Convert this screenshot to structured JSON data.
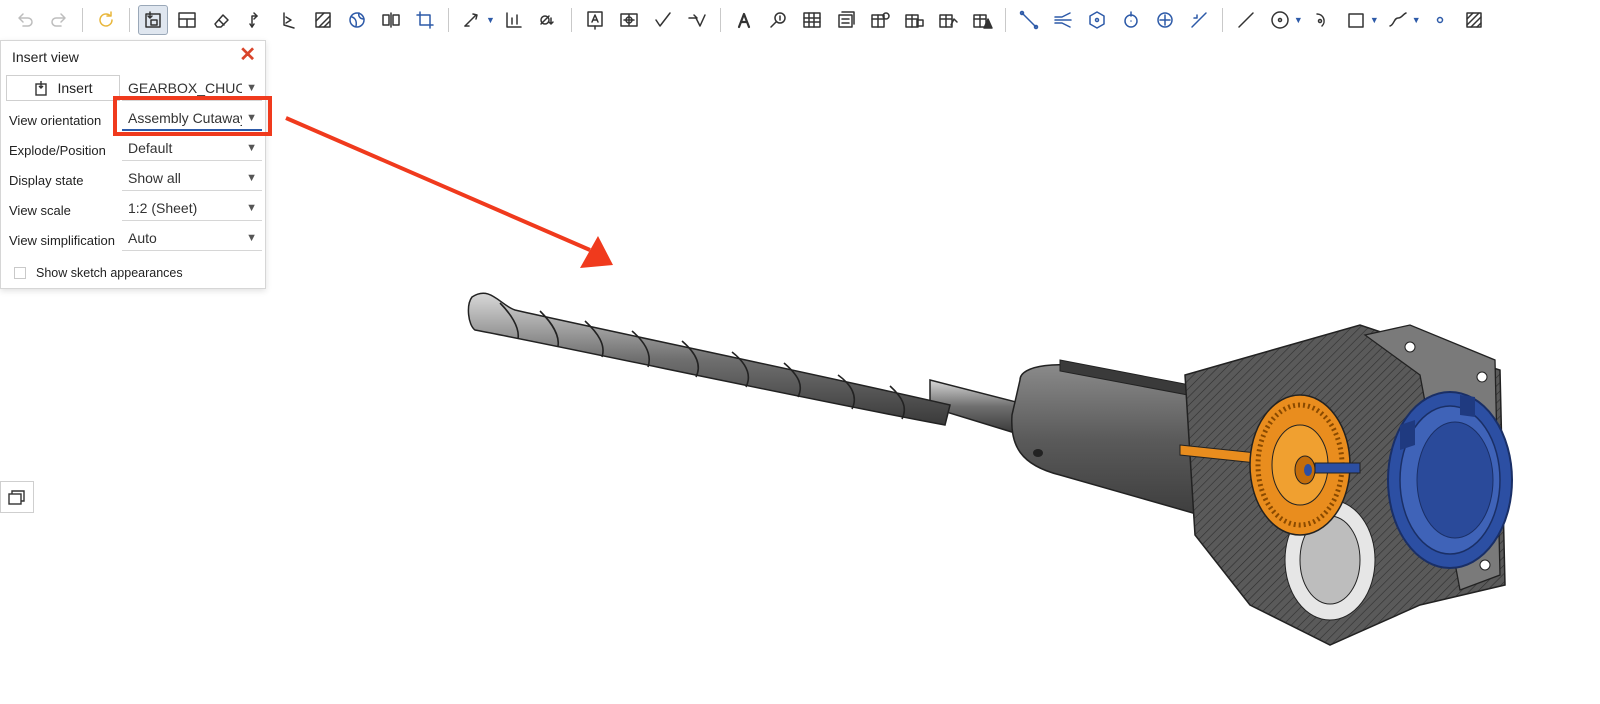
{
  "toolbar": {
    "icons": [
      "undo-icon",
      "redo-icon",
      "update-icon",
      "insert-view-icon",
      "layout-icon",
      "eraser-icon",
      "projected-view-icon",
      "auxiliary-view-icon",
      "section-view-icon",
      "broken-view-icon",
      "detail-view-icon",
      "crop-view-icon",
      "dimension-icon",
      "ordinate-dimension-icon",
      "diameter-dimension-icon",
      "note-icon",
      "datum-icon",
      "surface-finish-icon",
      "weld-symbol-icon",
      "text-icon",
      "callout-icon",
      "table-icon",
      "bom-table-icon",
      "hole-table-icon",
      "revision-table-icon",
      "bend-table-icon",
      "inspection-table-icon",
      "centerline-icon",
      "centermark-icon",
      "point-icon",
      "circle-center-icon",
      "crosshair-icon",
      "angle-icon",
      "line-icon",
      "circle-icon",
      "arc-icon",
      "rectangle-icon",
      "spline-icon",
      "small-circle-icon",
      "hatch-icon"
    ]
  },
  "panel": {
    "title": "Insert view",
    "insert_label": "Insert",
    "rows": [
      {
        "label": "",
        "value": "GEARBOX_CHUCK"
      },
      {
        "label": "View orientation",
        "value": "Assembly Cutaway"
      },
      {
        "label": "Explode/Position",
        "value": "Default"
      },
      {
        "label": "Display state",
        "value": "Show all"
      },
      {
        "label": "View scale",
        "value": "1:2 (Sheet)"
      },
      {
        "label": "View simplification",
        "value": "Auto"
      }
    ],
    "checkbox_label": "Show sketch appearances",
    "checkbox_checked": false
  },
  "colors": {
    "highlight": "#f03a1d",
    "close": "#d9452b",
    "accent": "#2d5aa8",
    "gear_orange": "#e98d1e",
    "cap_blue": "#2c4fa3",
    "body_gray": "#5e5e5e"
  }
}
